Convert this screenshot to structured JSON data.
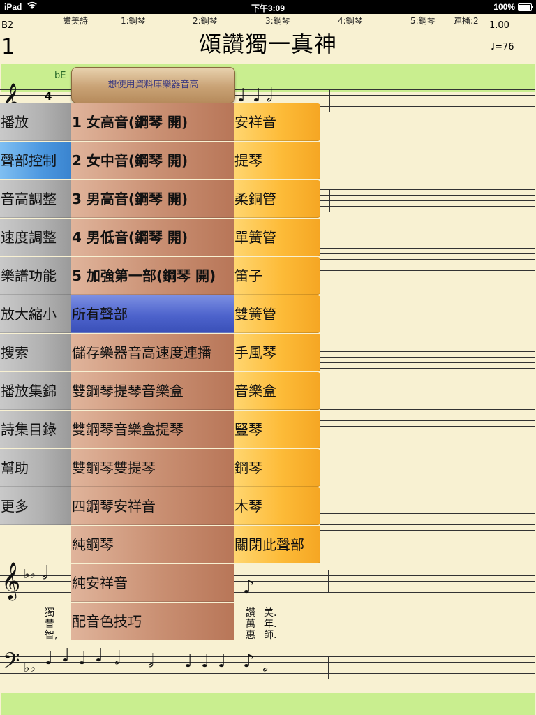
{
  "status": {
    "device": "iPad",
    "time": "下午3:09",
    "battery": "100%"
  },
  "header": {
    "tabs": [
      "讚美詩",
      "1:鋼琴",
      "2:鋼琴",
      "3:鋼琴",
      "4:鋼琴",
      "5:鋼琴",
      "連播:2"
    ],
    "voice": "B2",
    "page_number": "1",
    "title": "頌讚獨一真神",
    "zoom": "1.00",
    "tempo": "♩=76"
  },
  "score": {
    "key_label": "bE",
    "time_sig": "4",
    "lyrics": [
      {
        "text": "獨\n昔\n智,"
      },
      {
        "text": "讚\n萬\n惠"
      },
      {
        "text": "美.\n年.\n師."
      }
    ]
  },
  "menu": {
    "top_button": "想使用資料庫樂器音高",
    "main_items": [
      {
        "label": "播放",
        "active": false
      },
      {
        "label": "聲部控制",
        "active": true
      },
      {
        "label": "音高調整",
        "active": false
      },
      {
        "label": "速度調整",
        "active": false
      },
      {
        "label": "樂譜功能",
        "active": false
      },
      {
        "label": "放大縮小",
        "active": false
      },
      {
        "label": "搜索",
        "active": false
      },
      {
        "label": "播放集錦",
        "active": false
      },
      {
        "label": "詩集目錄",
        "active": false
      },
      {
        "label": "幫助",
        "active": false
      },
      {
        "label": "更多",
        "active": false
      }
    ],
    "voice_items": [
      {
        "num": "1",
        "label": "女高音(鋼琴 開)"
      },
      {
        "num": "2",
        "label": "女中音(鋼琴 開)"
      },
      {
        "num": "3",
        "label": "男高音(鋼琴 開)"
      },
      {
        "num": "4",
        "label": "男低音(鋼琴 開)"
      },
      {
        "num": "5",
        "label": "加強第一部(鋼琴 開)"
      },
      {
        "num": "",
        "label": "所有聲部",
        "active": true
      },
      {
        "num": "",
        "label": "儲存樂器音高速度連播"
      },
      {
        "num": "",
        "label": "雙鋼琴提琴音樂盒"
      },
      {
        "num": "",
        "label": "雙鋼琴音樂盒提琴"
      },
      {
        "num": "",
        "label": "雙鋼琴雙提琴"
      },
      {
        "num": "",
        "label": "四鋼琴安祥音"
      },
      {
        "num": "",
        "label": "純鋼琴"
      },
      {
        "num": "",
        "label": "純安祥音"
      },
      {
        "num": "",
        "label": "配音色技巧"
      }
    ],
    "instrument_items": [
      "安祥音",
      "提琴",
      "柔銅管",
      "單簧管",
      "笛子",
      "雙簧管",
      "手風琴",
      "音樂盒",
      "豎琴",
      "鋼琴",
      "木琴",
      "關閉此聲部"
    ]
  }
}
